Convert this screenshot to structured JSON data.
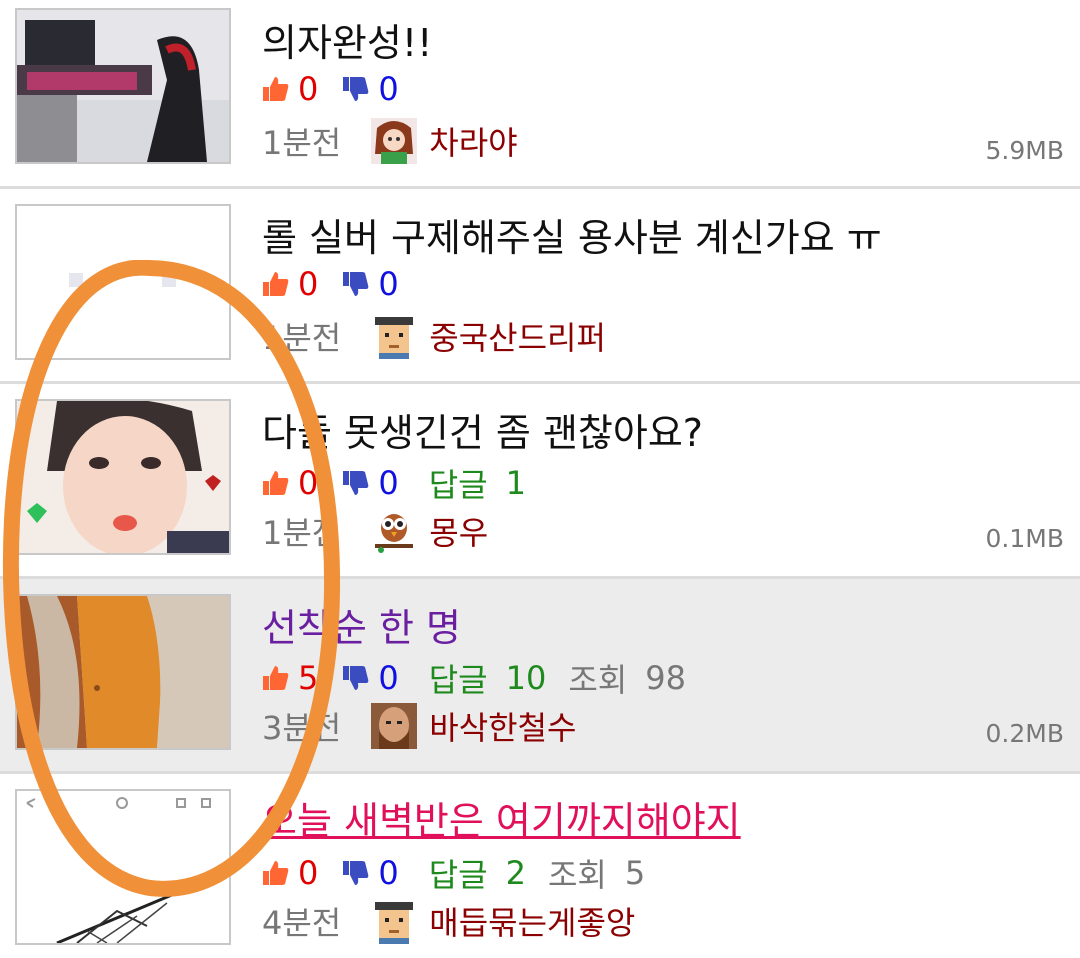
{
  "posts": [
    {
      "title": "의자완성!!",
      "up": "0",
      "down": "0",
      "reply_label": "",
      "reply_count": "",
      "view_label": "",
      "view_count": "",
      "time": "1분전",
      "author": "차라야",
      "size": "5.9MB",
      "thumb": "chair-photo"
    },
    {
      "title": "롤 실버 구제해주실 용사분 계신가요 ㅠ",
      "up": "0",
      "down": "0",
      "reply_label": "",
      "reply_count": "",
      "view_label": "",
      "view_count": "",
      "time": "1분전",
      "author": "중국산드리퍼",
      "size": "",
      "thumb": "blank-image"
    },
    {
      "title": "다들 못생긴건 좀 괜찮아요?",
      "up": "0",
      "down": "0",
      "reply_label": "답글",
      "reply_count": "1",
      "view_label": "",
      "view_count": "",
      "time": "1분전",
      "author": "몽우",
      "size": "0.1MB",
      "thumb": "selfie-photo"
    },
    {
      "title": "선착순 한 명",
      "up": "5",
      "down": "0",
      "reply_label": "답글",
      "reply_count": "10",
      "view_label": "조회",
      "view_count": "98",
      "time": "3분전",
      "author": "바삭한철수",
      "size": "0.2MB",
      "thumb": "jacket-photo"
    },
    {
      "title": "오늘 새벽반은 여기까지해야지",
      "up": "0",
      "down": "0",
      "reply_label": "답글",
      "reply_count": "2",
      "view_label": "조회",
      "view_count": "5",
      "time": "4분전",
      "author": "매듭묶는게좋앙",
      "size": "",
      "thumb": "sketch-image"
    }
  ],
  "colors": {
    "accent_up": "#e00000",
    "accent_down": "#1010e0",
    "reply": "#1e8a1e",
    "author": "#8b0000",
    "annotation": "#f0913a"
  }
}
